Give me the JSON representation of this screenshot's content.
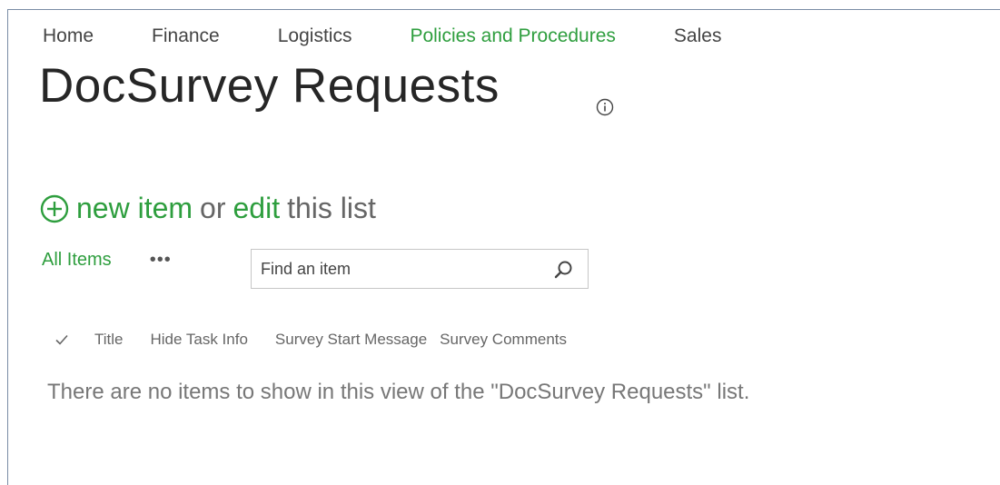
{
  "nav": {
    "items": [
      {
        "label": "Home"
      },
      {
        "label": "Finance"
      },
      {
        "label": "Logistics"
      },
      {
        "label": "Policies and Procedures"
      },
      {
        "label": "Sales"
      }
    ],
    "active_index": 3
  },
  "page": {
    "title": "DocSurvey Requests",
    "info_icon": "info-icon"
  },
  "actions": {
    "new_item_label": "new item",
    "or_text": "or",
    "edit_label": "edit",
    "this_list_text": "this list"
  },
  "views": {
    "all_items_label": "All Items",
    "more_label": "•••"
  },
  "search": {
    "placeholder": "Find an item",
    "value": ""
  },
  "table": {
    "columns": [
      "Title",
      "Hide Task Info",
      "Survey Start Message",
      "Survey Comments"
    ],
    "empty_message": "There are no items to show in this view of the \"DocSurvey Requests\" list."
  },
  "colors": {
    "accent": "#2e9e3e",
    "text": "#444444",
    "title": "#262626",
    "frame_border": "#7a8ca5"
  }
}
